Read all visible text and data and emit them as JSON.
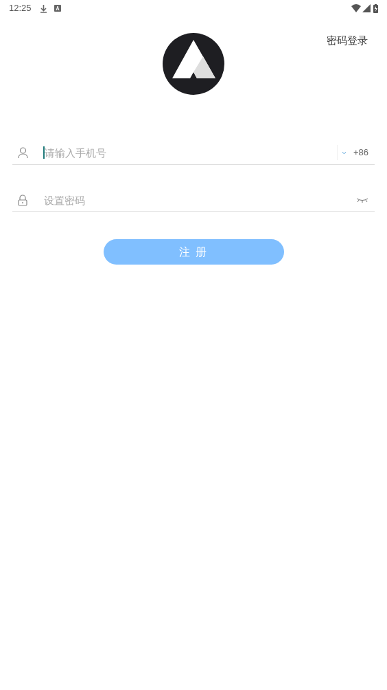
{
  "status_bar": {
    "time": "12:25"
  },
  "header": {
    "login_link": "密码登录"
  },
  "form": {
    "phone": {
      "placeholder": "请输入手机号",
      "focused": true,
      "country_code": "+86"
    },
    "password": {
      "placeholder": "设置密码"
    },
    "submit": "注 册"
  }
}
